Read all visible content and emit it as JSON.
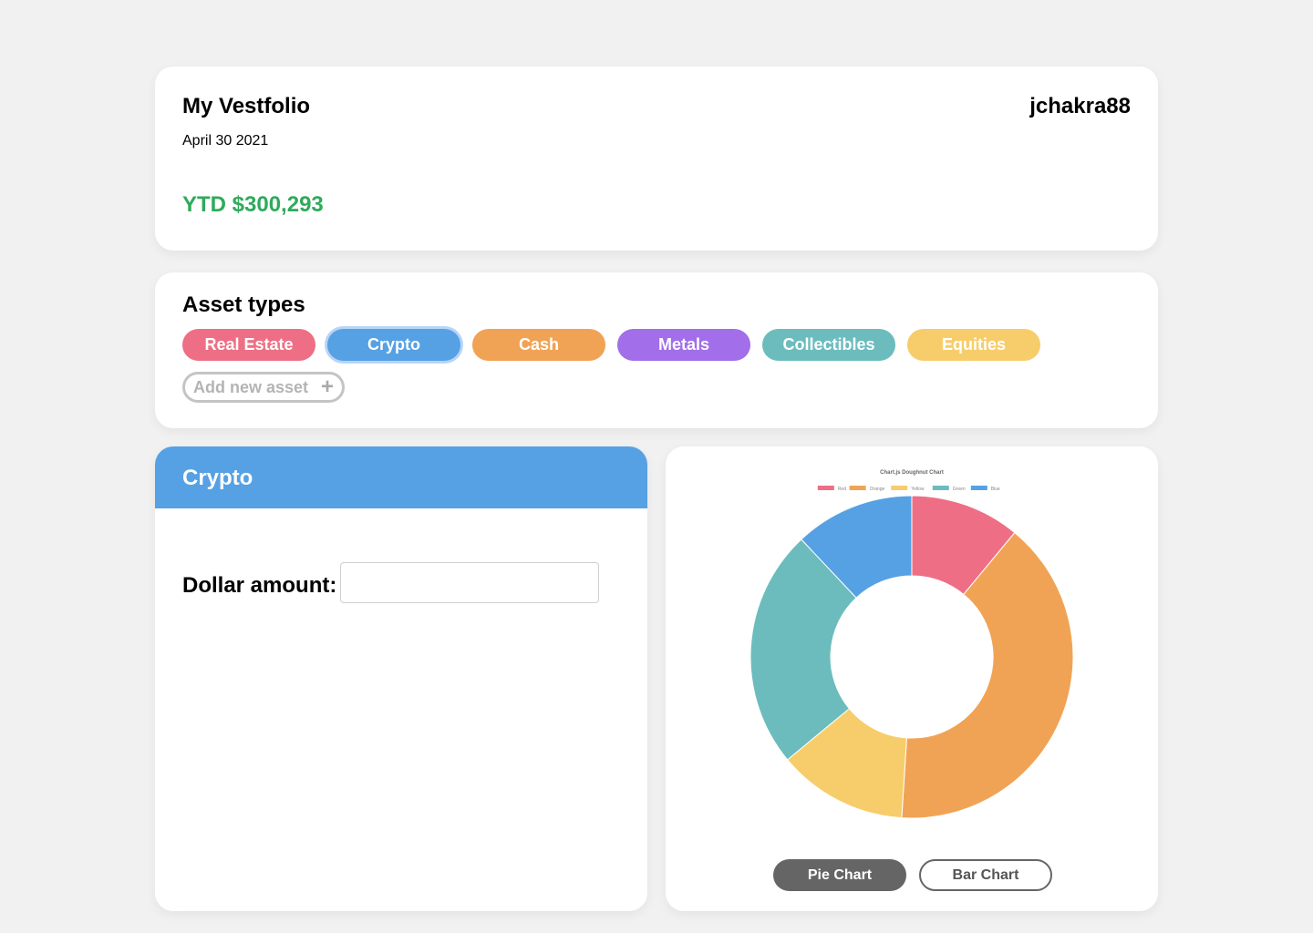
{
  "header": {
    "title": "My Vestfolio",
    "username": "jchakra88",
    "date": "April 30 2021",
    "ytd": "YTD $300,293",
    "ytd_color": "#2faa5c"
  },
  "assets": {
    "heading": "Asset types",
    "items": [
      {
        "label": "Real Estate",
        "color": "#ee6f85",
        "selected": false
      },
      {
        "label": "Crypto",
        "color": "#56a1e4",
        "selected": true
      },
      {
        "label": "Cash",
        "color": "#f1a355",
        "selected": false
      },
      {
        "label": "Metals",
        "color": "#a26ee9",
        "selected": false
      },
      {
        "label": "Collectibles",
        "color": "#6cbcbe",
        "selected": false
      },
      {
        "label": "Equities",
        "color": "#f7cd6b",
        "selected": false
      }
    ],
    "add_label": "Add new asset",
    "add_icon": "plus-icon"
  },
  "detail": {
    "title": "Crypto",
    "amount_label": "Dollar amount:",
    "amount_value": "",
    "amount_placeholder": ""
  },
  "chart_data": {
    "type": "pie",
    "title": "Chart.js Doughnut Chart",
    "categories": [
      "Red",
      "Orange",
      "Yellow",
      "Green",
      "Blue"
    ],
    "values": [
      11,
      40,
      13,
      24,
      12
    ],
    "colors": [
      "#ee6f85",
      "#f1a355",
      "#f7cd6b",
      "#6cbcbe",
      "#56a1e4"
    ],
    "doughnut": true,
    "legend": "top"
  },
  "chart_buttons": {
    "pie_label": "Pie Chart",
    "bar_label": "Bar Chart",
    "active": "pie"
  }
}
